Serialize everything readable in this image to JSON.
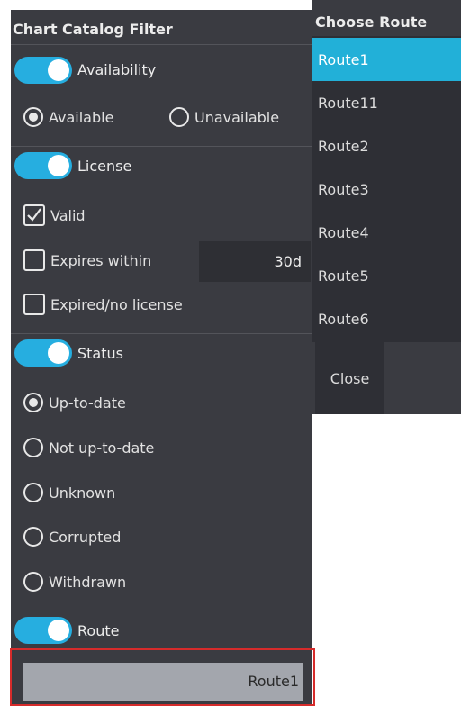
{
  "filter": {
    "title": "Chart Catalog Filter",
    "availability": {
      "toggle_label": "Availability",
      "enabled": true,
      "options": [
        {
          "label": "Available",
          "selected": true
        },
        {
          "label": "Unavailable",
          "selected": false
        }
      ]
    },
    "license": {
      "toggle_label": "License",
      "enabled": true,
      "valid": {
        "label": "Valid",
        "checked": true
      },
      "expires_within": {
        "label": "Expires within",
        "checked": false,
        "value": "30d"
      },
      "expired": {
        "label": "Expired/no license",
        "checked": false
      }
    },
    "status": {
      "toggle_label": "Status",
      "enabled": true,
      "options": [
        {
          "label": "Up-to-date",
          "selected": true
        },
        {
          "label": "Not up-to-date",
          "selected": false
        },
        {
          "label": "Unknown",
          "selected": false
        },
        {
          "label": "Corrupted",
          "selected": false
        },
        {
          "label": "Withdrawn",
          "selected": false
        }
      ]
    },
    "route": {
      "toggle_label": "Route",
      "enabled": true,
      "value": "Route1"
    }
  },
  "route_chooser": {
    "title": "Choose Route",
    "items": [
      "Route1",
      "Route11",
      "Route2",
      "Route3",
      "Route4",
      "Route5",
      "Route6"
    ],
    "selected": "Route1",
    "close_label": "Close"
  },
  "colors": {
    "accent": "#26aee0",
    "highlight_border": "#d62b2b",
    "panel_bg": "#3a3b41"
  }
}
